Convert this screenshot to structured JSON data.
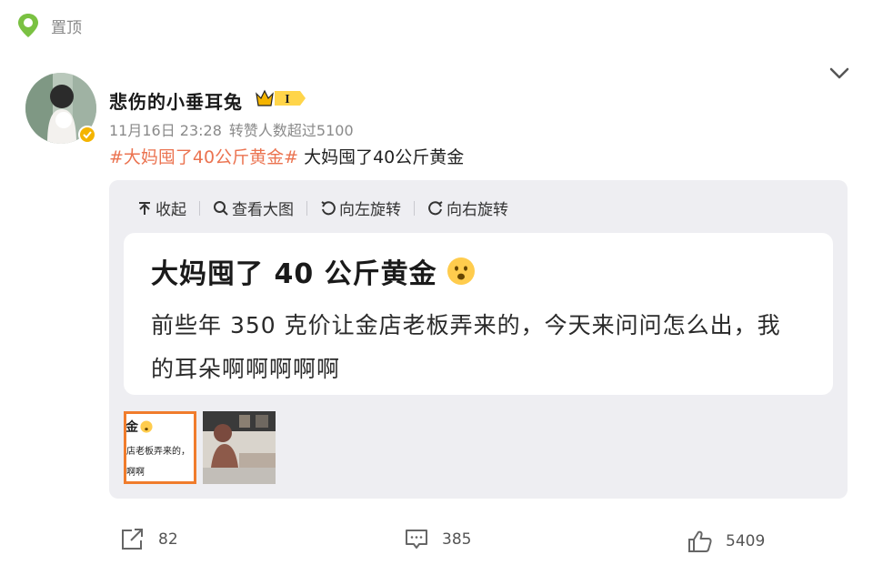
{
  "pin": {
    "icon": "pin-icon",
    "label": "置顶"
  },
  "post": {
    "username": "悲伤的小垂耳兔",
    "vip_level": "I",
    "date": "11月16日 23:28",
    "reposts_note": "转赞人数超过5100",
    "hashtag": "#大妈囤了40公斤黄金#",
    "text": " 大妈囤了40公斤黄金"
  },
  "toolbar": {
    "collapse": "收起",
    "view_large": "查看大图",
    "rotate_left": "向左旋转",
    "rotate_right": "向右旋转"
  },
  "image": {
    "title": "大妈囤了 40 公斤黄金",
    "body": "前些年 350 克价让金店老板弄来的，今天来问问怎么出，我的耳朵啊啊啊啊啊"
  },
  "thumbnails": {
    "first": {
      "line1": "金",
      "line2": "店老板弄来的，",
      "line3": "啊啊"
    }
  },
  "actions": {
    "share_count": "82",
    "comment_count": "385",
    "like_count": "5409"
  },
  "colors": {
    "hashtag": "#eb7350",
    "vip_gold": "#f4b400",
    "selected_thumb": "#f07c2c"
  }
}
